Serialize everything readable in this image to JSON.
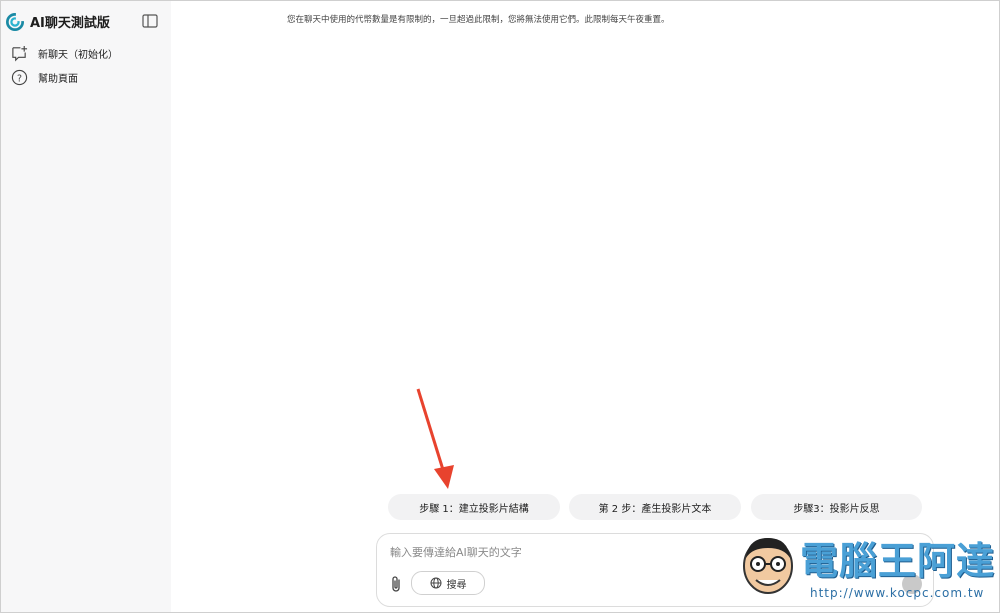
{
  "app": {
    "title": "AI聊天測試版"
  },
  "sidebar": {
    "items": [
      {
        "label": "新聊天（初始化）"
      },
      {
        "label": "幫助頁面"
      }
    ]
  },
  "main": {
    "notice": "您在聊天中使用的代幣數量是有限制的，一旦超過此限制，您將無法使用它們。此限制每天午夜重置。",
    "suggestions": [
      {
        "label": "步驟 1：建立投影片結構"
      },
      {
        "label": "第 2 步：產生投影片文本"
      },
      {
        "label": "步驟3：投影片反思"
      }
    ],
    "input": {
      "placeholder": "輸入要傳達給AI聊天的文字",
      "value": ""
    },
    "search_label": "搜尋"
  },
  "watermark": {
    "name": "電腦王阿達",
    "url": "http://www.kocpc.com.tw"
  },
  "colors": {
    "brand": "#1a8aa5",
    "arrow": "#e8432e",
    "watermark": "#4aa0d6"
  }
}
